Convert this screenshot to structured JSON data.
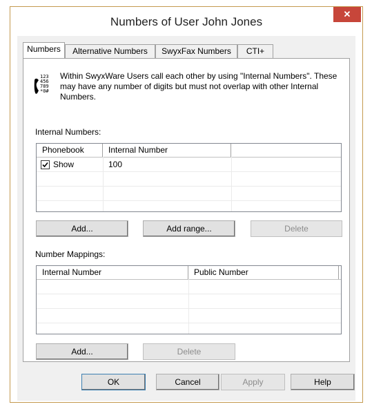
{
  "window": {
    "title": "Numbers of User John Jones",
    "close_glyph": "✕"
  },
  "tabs": [
    {
      "label": "Numbers",
      "active": true
    },
    {
      "label": "Alternative Numbers",
      "active": false
    },
    {
      "label": "SwyxFax Numbers",
      "active": false
    },
    {
      "label": "CTI+",
      "active": false
    }
  ],
  "info": {
    "icon": "phone-keypad-icon",
    "text": "Within SwyxWare Users call each other by using \"Internal Numbers\". These may have any number of digits but must not overlap with other Internal Numbers."
  },
  "internal_numbers": {
    "label": "Internal Numbers:",
    "columns": [
      "Phonebook",
      "Internal Number",
      ""
    ],
    "rows": [
      {
        "phonebook": "Show",
        "checked": true,
        "internal_number": "100"
      }
    ],
    "buttons": {
      "add": "Add...",
      "add_range": "Add range...",
      "delete": "Delete"
    }
  },
  "number_mappings": {
    "label": "Number Mappings:",
    "columns": [
      "Internal Number",
      "Public Number"
    ],
    "rows": [],
    "buttons": {
      "add": "Add...",
      "delete": "Delete"
    }
  },
  "footer": {
    "ok": "OK",
    "cancel": "Cancel",
    "apply": "Apply",
    "help": "Help"
  },
  "colors": {
    "border_accent": "#c49a4f",
    "close_red": "#c7463a",
    "dialog_bg": "#f0f0f0"
  }
}
